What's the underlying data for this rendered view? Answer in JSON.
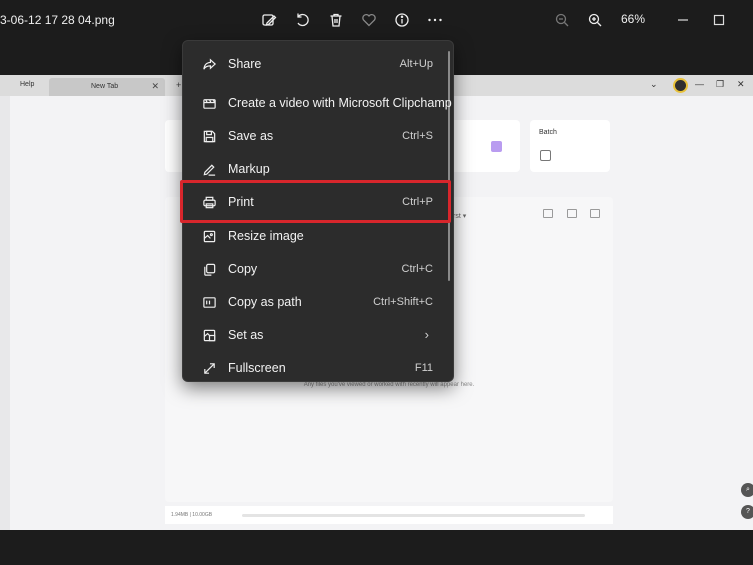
{
  "window": {
    "filename": "3-06-12 17 28 04.png",
    "zoom_level": "66%",
    "toolbar_icons": [
      "edit-image-icon",
      "rotate-icon",
      "delete-icon",
      "favorite-icon",
      "info-icon",
      "more-icon"
    ]
  },
  "inner_screenshot": {
    "help_tab": "Help",
    "new_tab": "New Tab",
    "batch_label": "Batch",
    "sort_label": "rst",
    "empty_message": "Any files you've viewed or worked with recently will appear here.",
    "storage_text": "1.94MB | 10.00GB"
  },
  "menu": {
    "items": [
      {
        "label": "Share",
        "shortcut": "Alt+Up",
        "icon": "share-icon"
      },
      {
        "label": "Create a video with Microsoft Clipchamp",
        "shortcut": "",
        "icon": "video-icon"
      },
      {
        "label": "Save as",
        "shortcut": "Ctrl+S",
        "icon": "save-icon"
      },
      {
        "label": "Markup",
        "shortcut": "",
        "icon": "markup-pen-icon"
      },
      {
        "label": "Print",
        "shortcut": "Ctrl+P",
        "icon": "printer-icon"
      },
      {
        "label": "Resize image",
        "shortcut": "",
        "icon": "resize-icon"
      },
      {
        "label": "Copy",
        "shortcut": "Ctrl+C",
        "icon": "copy-icon"
      },
      {
        "label": "Copy as path",
        "shortcut": "Ctrl+Shift+C",
        "icon": "copy-path-icon"
      },
      {
        "label": "Set as",
        "shortcut": "",
        "icon": "set-as-icon",
        "submenu": true
      },
      {
        "label": "Fullscreen",
        "shortcut": "F11",
        "icon": "fullscreen-icon"
      }
    ],
    "highlighted": "Print",
    "highlight_color": "#d8262c"
  }
}
